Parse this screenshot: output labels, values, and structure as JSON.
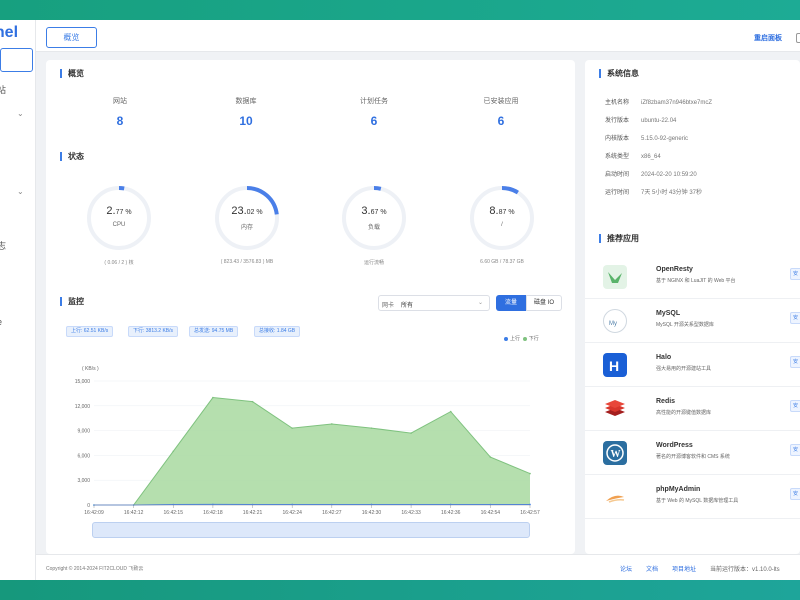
{
  "brand": {
    "logo_text": "anel"
  },
  "topbar": {
    "tab_overview": "概览",
    "restart_label": "重启面板"
  },
  "overview": {
    "title": "概览",
    "stats": [
      {
        "label": "网站",
        "value": "8"
      },
      {
        "label": "数据库",
        "value": "10"
      },
      {
        "label": "计划任务",
        "value": "6"
      },
      {
        "label": "已安装应用",
        "value": "6"
      }
    ]
  },
  "status": {
    "title": "状态",
    "gauges": [
      {
        "main": "2.",
        "small": "77 %",
        "name": "CPU",
        "foot": "( 0.06 / 2 ) 核",
        "percent": 2.77
      },
      {
        "main": "23.",
        "small": "02 %",
        "name": "内存",
        "foot": "( 823.43 / 3576.83 ) MB",
        "percent": 23.02
      },
      {
        "main": "3.",
        "small": "67 %",
        "name": "负载",
        "foot": "运行流畅",
        "percent": 3.67
      },
      {
        "main": "8.",
        "small": "87 %",
        "name": "/",
        "foot": "6.60 GB / 78.37 GB",
        "percent": 8.87
      }
    ]
  },
  "monitor": {
    "title": "监控",
    "select_label": "网卡",
    "select_value": "所有",
    "btn_traffic": "流量",
    "btn_io": "磁盘 IO",
    "tags": [
      "上行: 62.51 KB/s",
      "下行: 3813.2 KB/s",
      "总发送: 94.75 MB",
      "总接收: 1.84 GB"
    ],
    "legend_up": "上行",
    "legend_down": "下行"
  },
  "chart_data": {
    "type": "area",
    "ylabel": "( KB/s )",
    "ylim": [
      0,
      15000
    ],
    "yticks": [
      "15,000",
      "12,000",
      "9,000",
      "6,000",
      "3,000",
      "0"
    ],
    "x": [
      "16:42:09",
      "16:42:12",
      "16:42:15",
      "16:42:18",
      "16:42:21",
      "16:42:24",
      "16:42:27",
      "16:42:30",
      "16:42:33",
      "16:42:36",
      "16:42:54",
      "16:42:57"
    ],
    "series": [
      {
        "name": "上行",
        "color": "#3c7de6",
        "values": [
          0,
          0,
          60,
          70,
          60,
          65,
          60,
          62,
          60,
          65,
          60,
          62
        ]
      },
      {
        "name": "下行",
        "color": "#7fc27f",
        "values": [
          0,
          0,
          6500,
          13000,
          12500,
          9300,
          9800,
          9300,
          8700,
          11300,
          5800,
          3800
        ]
      }
    ]
  },
  "sysinfo": {
    "title": "系统信息",
    "rows": [
      {
        "key": "主机名称",
        "value": "iZf8zbam37n946btxe7mcZ"
      },
      {
        "key": "发行版本",
        "value": "ubuntu-22.04"
      },
      {
        "key": "内核版本",
        "value": "5.15.0-92-generic"
      },
      {
        "key": "系统类型",
        "value": "x86_64"
      },
      {
        "key": "启动时间",
        "value": "2024-02-20 10:59:20"
      },
      {
        "key": "运行时间",
        "value": "7天 5小时 43分钟 37秒"
      }
    ]
  },
  "apps": {
    "title": "推荐应用",
    "install_label": "安",
    "items": [
      {
        "name": "OpenResty",
        "desc": "基于 NGINX 和 LuaJIT 的 Web 平台",
        "icon": "openresty-icon",
        "color": "#e3f3e6"
      },
      {
        "name": "MySQL",
        "desc": "MySQL 开源关系型数据库",
        "icon": "mysql-icon",
        "color": "#4f7fa8"
      },
      {
        "name": "Halo",
        "desc": "强大易用的开源建站工具",
        "icon": "halo-icon",
        "color": "#1a5fd6"
      },
      {
        "name": "Redis",
        "desc": "高性能的开源键值数据库",
        "icon": "redis-icon",
        "color": "#d8362c"
      },
      {
        "name": "WordPress",
        "desc": "著名的开源博客软件和 CMS 系统",
        "icon": "wordpress-icon",
        "color": "#2b6ea0"
      },
      {
        "name": "phpMyAdmin",
        "desc": "基于 Web 的 MySQL 数据库管理工具",
        "icon": "phpmyadmin-icon",
        "color": "#f1c89a"
      }
    ]
  },
  "footer": {
    "copyright": "Copyright © 2014-2024 FIT2CLOUD 飞致云",
    "forum": "论坛",
    "docs": "文档",
    "project": "项目地址",
    "version": "当前运行版本：v1.10.0-lts"
  }
}
